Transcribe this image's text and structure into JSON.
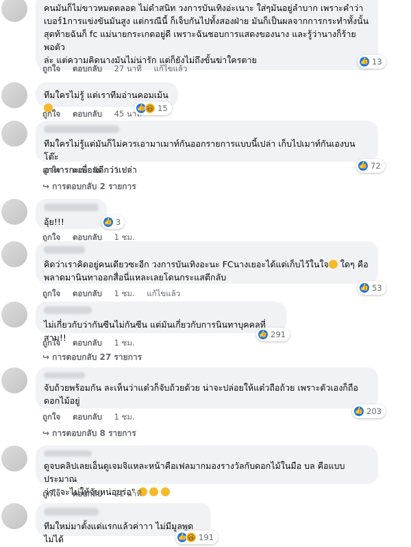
{
  "colors": {
    "bubble": "#f0f2f5",
    "like": "#1877f2",
    "haha": "#f7b928",
    "meta": "#65676b"
  },
  "comments": [
    {
      "text": "คนมันก็ไม่ขาวหมดตลอด ไม่ดำสนิท วงการบันเทิงอ่ะเนาะ ใส่ๆมันอยู่ลำบาก เพราะคำว่า\nเบอร์1การแข่งขันมันสูง แต่กรณีนี้ ก็เจ็บกันไปทั้งสองฝ่าย มันก็เป็นผลจากการกระทำทั้งนั้น\nสุดท้ายฉันก็ fc แม่นายกระเกดอยู่ดี เพราะฉันชอบการแสดงของนาง และรู้ว่านางก็ร้ายพอตัว\nล่ะ แต่ความคิดนางมันไม่น่ารัก แต่ก็ยังไม่ถึงขั้นฆ่าใครตาย",
      "like": "ถูกใจ",
      "reply": "ตอบกลับ",
      "time": "27 นาที",
      "edited": "แก้ไขแล้ว",
      "reaction_count": "13",
      "reactions": [
        "like"
      ]
    },
    {
      "text": "ทีมใครไม่รู้ แต่เราทีมอ่านคอมเม้น",
      "like": "ถูกใจ",
      "reply": "ตอบกลับ",
      "time": "45 นาที",
      "reaction_count": "15",
      "reactions": [
        "like",
        "haha"
      ]
    },
    {
      "text": "ทีมใครไม่รู้แต่มันก็ไม่ควรเอามาเมาท์กันออกรายการแบบนี้เปล่า เก็บไปเมาท์กันเองบนโต๊ะ\nอาหารกะเพื่อนดีกว่าเปล่า",
      "like": "ถูกใจ",
      "reply": "ตอบกลับ",
      "time": "1 ชม.",
      "reaction_count": "72",
      "reactions": [
        "like"
      ],
      "replies": "การตอบกลับ 2 รายการ"
    },
    {
      "text": "อุ้ย!!!",
      "like": "ถูกใจ",
      "reply": "ตอบกลับ",
      "time": "1 ชม.",
      "reaction_count": "3",
      "reactions": [
        "like"
      ]
    },
    {
      "text": "คิดว่าเราคิดอยู่คนเดียวซะอีก วงการบันเทิงอะนะ FCนางเยอะได้แต่เก็บไว้ในใจ",
      "text2": " ใดๆ คือ\nพลาดมานินทาออกสื่อนี่แหละเลยโดนกระแสตีกลับ",
      "like": "ถูกใจ",
      "reply": "ตอบกลับ",
      "time": "1 ชม.",
      "edited": "แก้ไขแล้ว",
      "reaction_count": "53",
      "reactions": [
        "like"
      ]
    },
    {
      "text": "ไม่เกี่ยวกับว่ากันซีนไม่กันซีน แต่มันเกี่ยวกับการนินทาบุคคลที่สาม!!",
      "like": "ถูกใจ",
      "reply": "ตอบกลับ",
      "time": "1 ชม.",
      "reaction_count": "291",
      "reactions": [
        "like"
      ],
      "replies": "การตอบกลับ 27 รายการ"
    },
    {
      "text": "จับถ้วยพร้อมกัน ละเห็นว่าแต๋วก็จับถ้วยด้วย น่าจะปล่อยให้แต๋วถือถ้วย เพราะตัวเองก็ถือ\nดอกไม้อยู่",
      "like": "ถูกใจ",
      "reply": "ตอบกลับ",
      "time": "1 ชม.",
      "reaction_count": "203",
      "reactions": [
        "like"
      ],
      "replies": "การตอบกลับ 8 รายการ"
    },
    {
      "text": "ดูจบคลิปเลยเอ็นดูเจมจิแหละหน้าคือเฟลมากมองรางวัลกับดอกไม้ในมือ บล คือแบบประมาณ\nว่า \"จะไม่ให้จับหน่อยร่อ\"",
      "like": "ถูกใจ",
      "reply": "ตอบกลับ",
      "time": "21 นาที"
    },
    {
      "text": "ทีมใหม่มาตั้งแต่แรกแล้วค่าาา ไม่มีมูลพูดไม่ได้",
      "reaction_count": "191",
      "reactions": [
        "like",
        "haha"
      ]
    }
  ]
}
